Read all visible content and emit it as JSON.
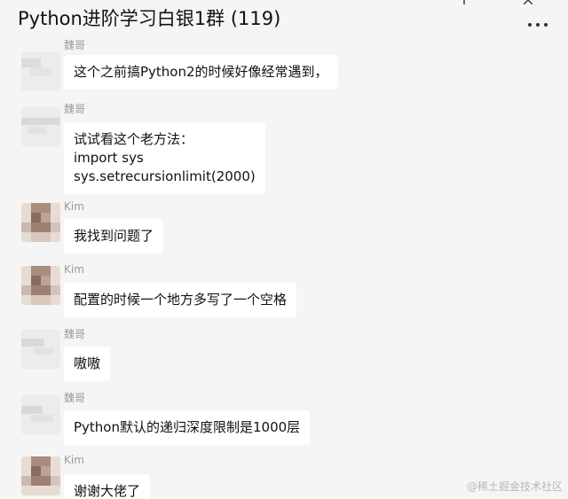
{
  "header": {
    "title": "Python进阶学习白银1群 (119)",
    "add_icon": "plus-icon",
    "close_icon": "close-icon",
    "more_icon": "more-icon"
  },
  "messages": [
    {
      "sender": "魏哥",
      "avatar": "blurred-avatar-grey",
      "text": "这个之前搞Python2的时候好像经常遇到，"
    },
    {
      "sender": "魏哥",
      "avatar": "blurred-avatar-grey",
      "text": "试试看这个老方法：\nimport sys\nsys.setrecursionlimit(2000)"
    },
    {
      "sender": "Kim",
      "avatar": "blurred-avatar-kim",
      "text": "我找到问题了"
    },
    {
      "sender": "Kim",
      "avatar": "blurred-avatar-kim",
      "text": "配置的时候一个地方多写了一个空格"
    },
    {
      "sender": "魏哥",
      "avatar": "blurred-avatar-grey",
      "text": "嗷嗷"
    },
    {
      "sender": "魏哥",
      "avatar": "blurred-avatar-grey",
      "text": "Python默认的递归深度限制是1000层"
    },
    {
      "sender": "Kim",
      "avatar": "blurred-avatar-kim",
      "text": "谢谢大佬了"
    }
  ],
  "watermark": "@稀土掘金技术社区",
  "colors": {
    "background": "#f5f5f5",
    "bubble": "#ffffff",
    "sender_name": "#9a9a9a"
  }
}
